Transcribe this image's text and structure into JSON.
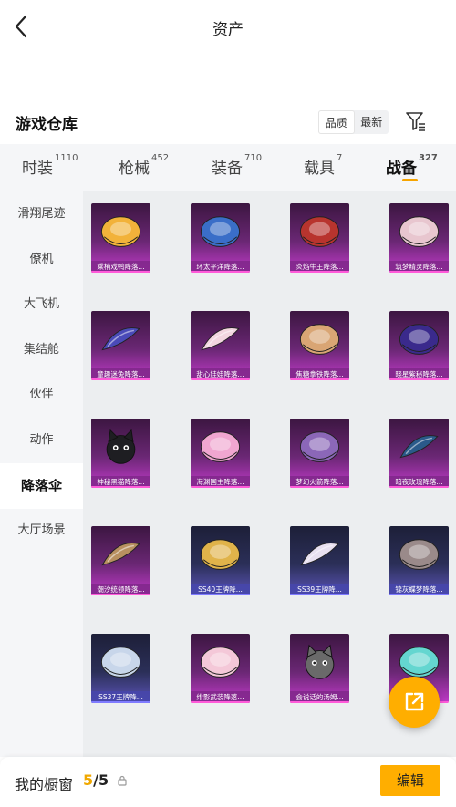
{
  "header": {
    "title": "资产"
  },
  "warehouse": {
    "title": "游戏仓库",
    "sort_quality": "品质",
    "sort_latest": "最新"
  },
  "tabs": [
    {
      "label": "时装",
      "count": "1110"
    },
    {
      "label": "枪械",
      "count": "452"
    },
    {
      "label": "装备",
      "count": "710"
    },
    {
      "label": "载具",
      "count": "7"
    },
    {
      "label": "战备",
      "count": "327"
    }
  ],
  "active_tab": "战备",
  "side_nav": [
    {
      "label": "滑翔尾迹"
    },
    {
      "label": "僚机"
    },
    {
      "label": "大飞机"
    },
    {
      "label": "集结舱"
    },
    {
      "label": "伙伴"
    },
    {
      "label": "动作"
    },
    {
      "label": "降落伞"
    },
    {
      "label": "大厅场景"
    }
  ],
  "active_side": "降落伞",
  "items": [
    {
      "name": "乘梢戏鸭降落...",
      "rarity": "purple",
      "color": "#f2b23a",
      "shape": "dome"
    },
    {
      "name": "环太平洋降落...",
      "rarity": "purple",
      "color": "#3a6ec8",
      "shape": "dome"
    },
    {
      "name": "炎焰牛王降落...",
      "rarity": "purple",
      "color": "#b8342e",
      "shape": "dome"
    },
    {
      "name": "筑梦精灵降落...",
      "rarity": "purple",
      "color": "#e8c6cf",
      "shape": "dome"
    },
    {
      "name": "童趣迷兔降落...",
      "rarity": "purple",
      "color": "#4a4ab8",
      "shape": "wing"
    },
    {
      "name": "甜心娃娃降落...",
      "rarity": "purple",
      "color": "#f3d6e0",
      "shape": "wing"
    },
    {
      "name": "焦糖拿铁降落...",
      "rarity": "purple",
      "color": "#d9a574",
      "shape": "dome"
    },
    {
      "name": "晓星紫秘降落...",
      "rarity": "purple",
      "color": "#3a2a8c",
      "shape": "dome"
    },
    {
      "name": "神秘黑猫降落...",
      "rarity": "purple",
      "color": "#1e1e22",
      "shape": "cat"
    },
    {
      "name": "海渊国主降落...",
      "rarity": "purple",
      "color": "#f0a6d0",
      "shape": "dome"
    },
    {
      "name": "梦幻火箭降落...",
      "rarity": "purple",
      "color": "#8b67b8",
      "shape": "dome"
    },
    {
      "name": "暗夜玫瑰降落...",
      "rarity": "purple",
      "color": "#2a5a8a",
      "shape": "wing"
    },
    {
      "name": "潮汐统领降落...",
      "rarity": "purple",
      "color": "#b89060",
      "shape": "wing"
    },
    {
      "name": "SS40王牌降...",
      "rarity": "blue",
      "color": "#e0b34a",
      "shape": "dome"
    },
    {
      "name": "SS39王牌降...",
      "rarity": "blue",
      "color": "#e8e0f0",
      "shape": "wing"
    },
    {
      "name": "锦灰蝶梦降落...",
      "rarity": "blue",
      "color": "#9a8a8a",
      "shape": "dome"
    },
    {
      "name": "SS37王牌降...",
      "rarity": "blue",
      "color": "#c8d6ea",
      "shape": "dome"
    },
    {
      "name": "绯影武装降落...",
      "rarity": "purple",
      "color": "#f4c8d8",
      "shape": "dome"
    },
    {
      "name": "会说话的汤姆...",
      "rarity": "purple",
      "color": "#6a6a6a",
      "shape": "cat"
    },
    {
      "name": "",
      "rarity": "purple",
      "color": "#64d6d0",
      "shape": "dome"
    }
  ],
  "bottom": {
    "label": "我的橱窗",
    "current": "5",
    "separator": "/",
    "total": "5",
    "edit_label": "编辑"
  },
  "accent_color": "#ffae00"
}
